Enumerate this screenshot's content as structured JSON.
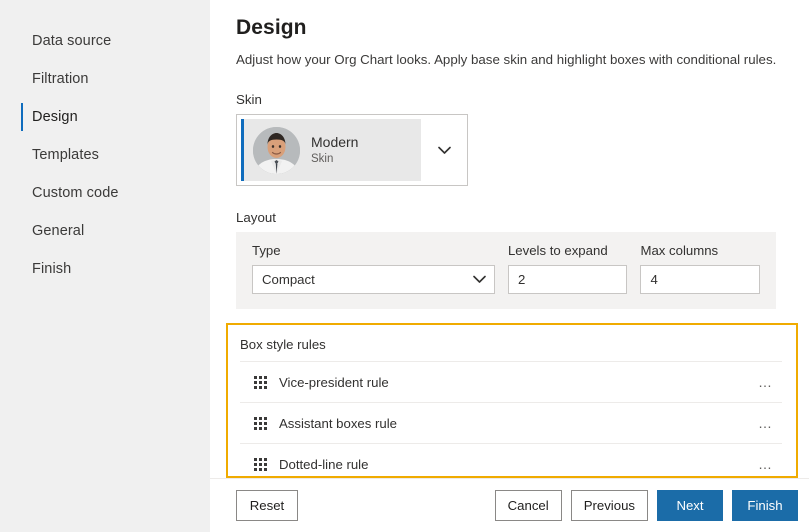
{
  "sidebar": {
    "items": [
      {
        "label": "Data source",
        "active": false
      },
      {
        "label": "Filtration",
        "active": false
      },
      {
        "label": "Design",
        "active": true
      },
      {
        "label": "Templates",
        "active": false
      },
      {
        "label": "Custom code",
        "active": false
      },
      {
        "label": "General",
        "active": false
      },
      {
        "label": "Finish",
        "active": false
      }
    ]
  },
  "main": {
    "title": "Design",
    "subtitle": "Adjust how your Org Chart looks. Apply base skin and highlight boxes with conditional rules.",
    "skin": {
      "section_label": "Skin",
      "name": "Modern",
      "subtitle": "Skin",
      "chevron_icon": "chevron-down-icon",
      "accent_color": "#0f6cbd"
    },
    "layout": {
      "section_label": "Layout",
      "fields": [
        {
          "label": "Type",
          "value": "Compact",
          "kind": "select"
        },
        {
          "label": "Levels to expand",
          "value": "2",
          "kind": "text"
        },
        {
          "label": "Max columns",
          "value": "4",
          "kind": "text"
        }
      ]
    },
    "box_style_rules": {
      "section_label": "Box style rules",
      "highlight_color": "#f0ab00",
      "more_icon": "ellipsis-icon",
      "drag_icon": "drag-handle-icon",
      "rules": [
        {
          "name": "Vice-president rule"
        },
        {
          "name": "Assistant boxes rule"
        },
        {
          "name": "Dotted-line rule"
        }
      ]
    }
  },
  "footer": {
    "reset_label": "Reset",
    "cancel_label": "Cancel",
    "previous_label": "Previous",
    "next_label": "Next",
    "finish_label": "Finish",
    "primary_color": "#1b6ca8"
  }
}
